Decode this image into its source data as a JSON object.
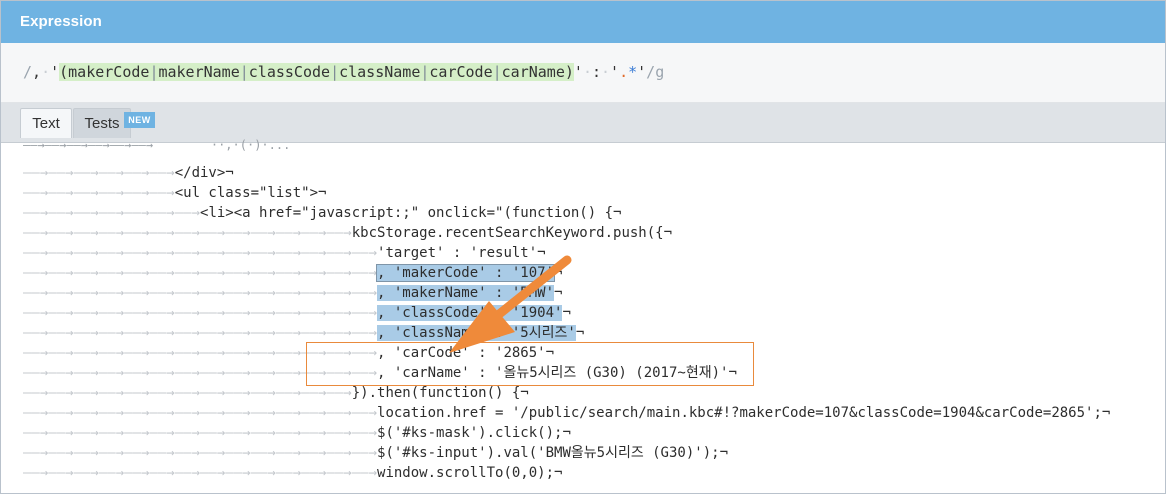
{
  "expression": {
    "title": "Expression",
    "open_delim": "/",
    "comma": ",",
    "q_open": "'",
    "paren_open": "(",
    "alts": [
      "makerCode",
      "makerName",
      "classCode",
      "className",
      "carCode",
      "carName"
    ],
    "pipe": "|",
    "paren_close": ")",
    "q_close": "'",
    "colon": ":",
    "q2_open": "'",
    "any": ".",
    "star": "*",
    "q2_close": "'",
    "close_delim": "/",
    "flags": "g"
  },
  "tabs": {
    "text_label": "Text",
    "tests_label": "Tests",
    "new_badge": "NEW"
  },
  "code_lines": [
    {
      "ws": "——→——→——→——→——→——→",
      "text": "</div>¬"
    },
    {
      "ws": "——→——→——→——→——→——→",
      "text": "<ul class=\"list\">¬"
    },
    {
      "ws": "——→——→——→——→——→——→——→",
      "text": "<li><a href=\"javascript:;\" onclick=\"(function() {¬"
    },
    {
      "ws": "——→——→——→——→——→——→——→——→——→——→——→——→——→",
      "text": "kbcStorage.recentSearchKeyword.push({¬"
    },
    {
      "ws": "——→——→——→——→——→——→——→——→——→——→——→——→——→——→",
      "text": "'target' : 'result'¬"
    },
    {
      "ws": "——→——→——→——→——→——→——→——→——→——→——→——→——→——→",
      "text": ", 'makerCode' : '107'",
      "tail": "¬",
      "hl": true,
      "box": true
    },
    {
      "ws": "——→——→——→——→——→——→——→——→——→——→——→——→——→——→",
      "text": ", 'makerName' : 'BMW'",
      "tail": "¬",
      "hl": true
    },
    {
      "ws": "——→——→——→——→——→——→——→——→——→——→——→——→——→——→",
      "text": ", 'classCode' : '1904'",
      "tail": "¬",
      "hl": true
    },
    {
      "ws": "——→——→——→——→——→——→——→——→——→——→——→——→——→——→",
      "text": ", 'className' : '5시리즈'",
      "tail": "¬",
      "hl": true
    },
    {
      "ws": "——→——→——→——→——→——→——→——→——→——→——→——→——→——→",
      "text": ", 'carCode' : '2865'¬"
    },
    {
      "ws": "——→——→——→——→——→——→——→——→——→——→——→——→——→——→",
      "text": ", 'carName' : '올뉴5시리즈 (G30) (2017~현재)'¬"
    },
    {
      "ws": "——→——→——→——→——→——→——→——→——→——→——→——→——→",
      "text": "}).then(function() {¬"
    },
    {
      "ws": "——→——→——→——→——→——→——→——→——→——→——→——→——→——→",
      "text": "location.href = '/public/search/main.kbc#!?makerCode=107&classCode=1904&carCode=2865';¬"
    },
    {
      "ws": "——→——→——→——→——→——→——→——→——→——→——→——→——→——→",
      "text": "$('#ks-mask').click();¬"
    },
    {
      "ws": "——→——→——→——→——→——→——→——→——→——→——→——→——→——→",
      "text": "$('#ks-input').val('BMW올뉴5시리즈 (G30)');¬"
    },
    {
      "ws": "——→——→——→——→——→——→——→——→——→——→——→——→——→——→",
      "text": "window.scrollTo(0,0);¬"
    }
  ],
  "colors": {
    "header": "#6fb3e2",
    "match_highlight": "#a9cbe6",
    "group_highlight": "#d5efc8",
    "annotation": "#e98a3c"
  },
  "annotation": {
    "arrow-icon": "arrow-icon",
    "box": "orange-highlight-box"
  }
}
